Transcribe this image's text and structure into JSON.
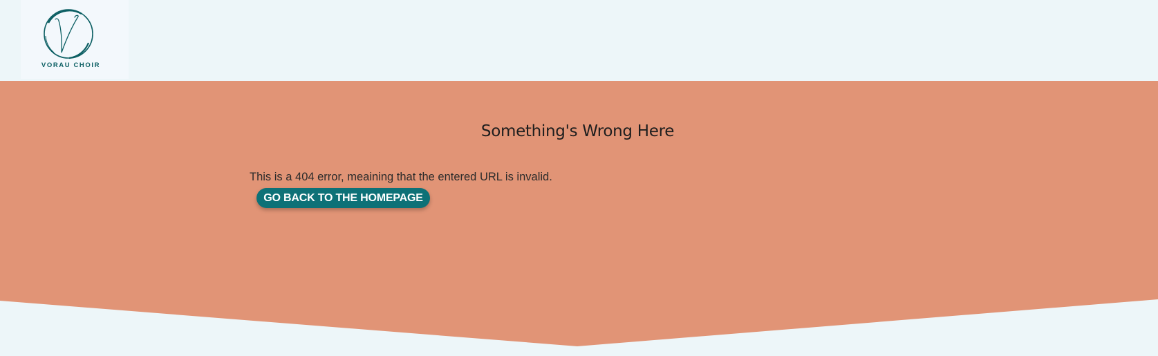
{
  "header": {
    "logo": {
      "text": "VORAU CHOIR",
      "icon": "script-v-circle-logo",
      "color": "#0c5f63"
    }
  },
  "hero": {
    "background_color": "#e19476",
    "title": "Something's Wrong Here",
    "message": "This is a 404 error, meaining that the entered URL is invalid.",
    "button_label": "GO BACK TO THE HOMEPAGE",
    "button_color": "#0d7177"
  },
  "colors": {
    "page_background": "#edf6f9",
    "accent": "#0d7177",
    "hero": "#e19476"
  }
}
